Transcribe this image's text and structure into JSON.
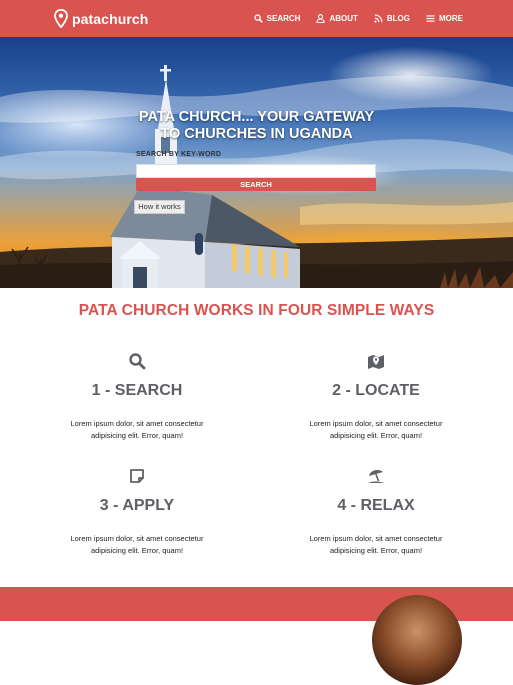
{
  "brand": {
    "name": "patachurch"
  },
  "nav": {
    "items": [
      {
        "label": "SEARCH",
        "icon": "search-icon"
      },
      {
        "label": "ABOUT",
        "icon": "user-icon"
      },
      {
        "label": "BLOG",
        "icon": "rss-icon"
      },
      {
        "label": "MORE",
        "icon": "menu-icon"
      }
    ]
  },
  "hero": {
    "title_line1": "PATA CHURCH... YOUR GATEWAY",
    "title_line2": "TO CHURCHES IN UGANDA",
    "search_label": "SEARCH BY KEY-WORD",
    "search_value": "",
    "search_button": "SEARCH",
    "how_button": "How it works"
  },
  "features": {
    "title": "PATA CHURCH WORKS IN FOUR SIMPLE WAYS",
    "items": [
      {
        "heading": "1 - SEARCH",
        "icon": "search-icon",
        "line1": "Lorem ipsum dolor, sit amet consectetur",
        "line2": "adipisicing elit. Error, quam!"
      },
      {
        "heading": "2 - LOCATE",
        "icon": "map-icon",
        "line1": "Lorem ipsum dolor, sit amet consectetur",
        "line2": "adipisicing elit. Error, quam!"
      },
      {
        "heading": "3 - APPLY",
        "icon": "sticky-note-icon",
        "line1": "Lorem ipsum dolor, sit amet consectetur",
        "line2": "adipisicing elit. Error, quam!"
      },
      {
        "heading": "4 - RELAX",
        "icon": "umbrella-beach-icon",
        "line1": "Lorem ipsum dolor, sit amet consectetur",
        "line2": "adipisicing elit. Error, quam!"
      }
    ]
  },
  "colors": {
    "accent": "#d9534f",
    "heading_gray": "#5e6066"
  }
}
